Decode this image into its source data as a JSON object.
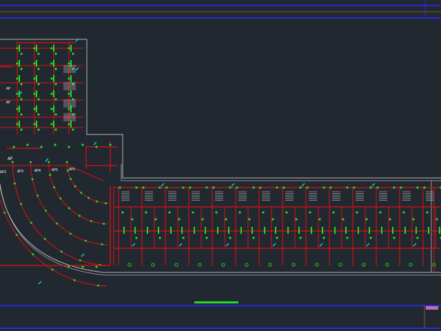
{
  "app": {
    "window_kind": "CAD drawing viewport",
    "background_color": "#212830"
  },
  "colors": {
    "border_blue": "#2b2bd6",
    "wall_red": "#e01010",
    "node_green": "#22dd22",
    "accent_cyan": "#00d8ff",
    "outline_gray": "#b8b8b8",
    "text_white": "#ffffff",
    "scroll_indicator_green": "#22dd22",
    "swatch_magenta": "#c070b0"
  },
  "drawing": {
    "labels": {
      "ap": "AP",
      "ring_labels": [
        "AP6",
        "AP5",
        "AP4",
        "AP3",
        "AP2"
      ],
      "block_label": "AP"
    }
  },
  "status": {
    "horizontal_scroll_indicator": "visible",
    "corner_swatch": "visible"
  }
}
